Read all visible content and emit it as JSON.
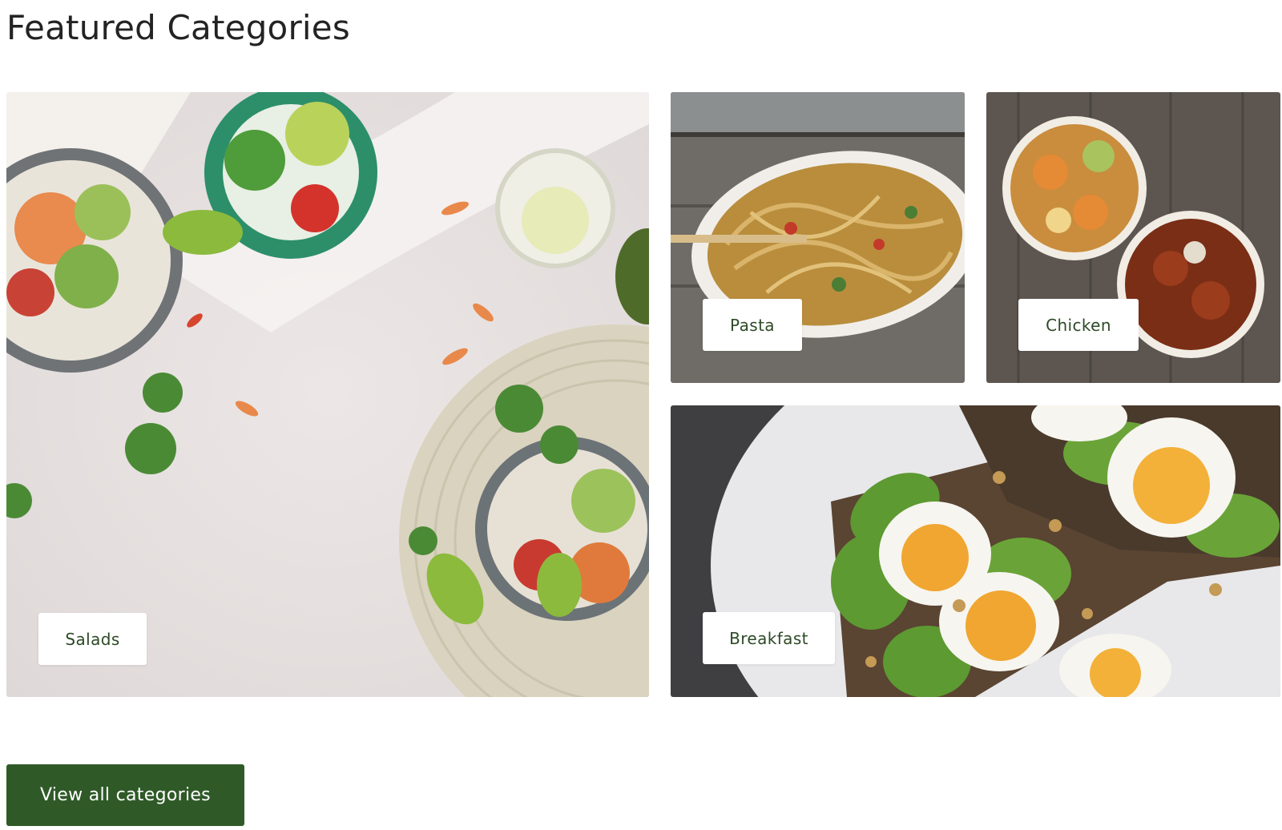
{
  "section": {
    "title": "Featured Categories"
  },
  "categories": [
    {
      "label": "Salads",
      "image": "salad-bowls-photo"
    },
    {
      "label": "Pasta",
      "image": "noodles-bowl-photo"
    },
    {
      "label": "Chicken",
      "image": "chicken-curry-bowls-photo"
    },
    {
      "label": "Breakfast",
      "image": "avocado-egg-toast-photo"
    }
  ],
  "actions": {
    "view_all_label": "View all categories"
  },
  "colors": {
    "accent": "#2f5a28",
    "label_text": "#2d4a26",
    "title_text": "#232323"
  }
}
